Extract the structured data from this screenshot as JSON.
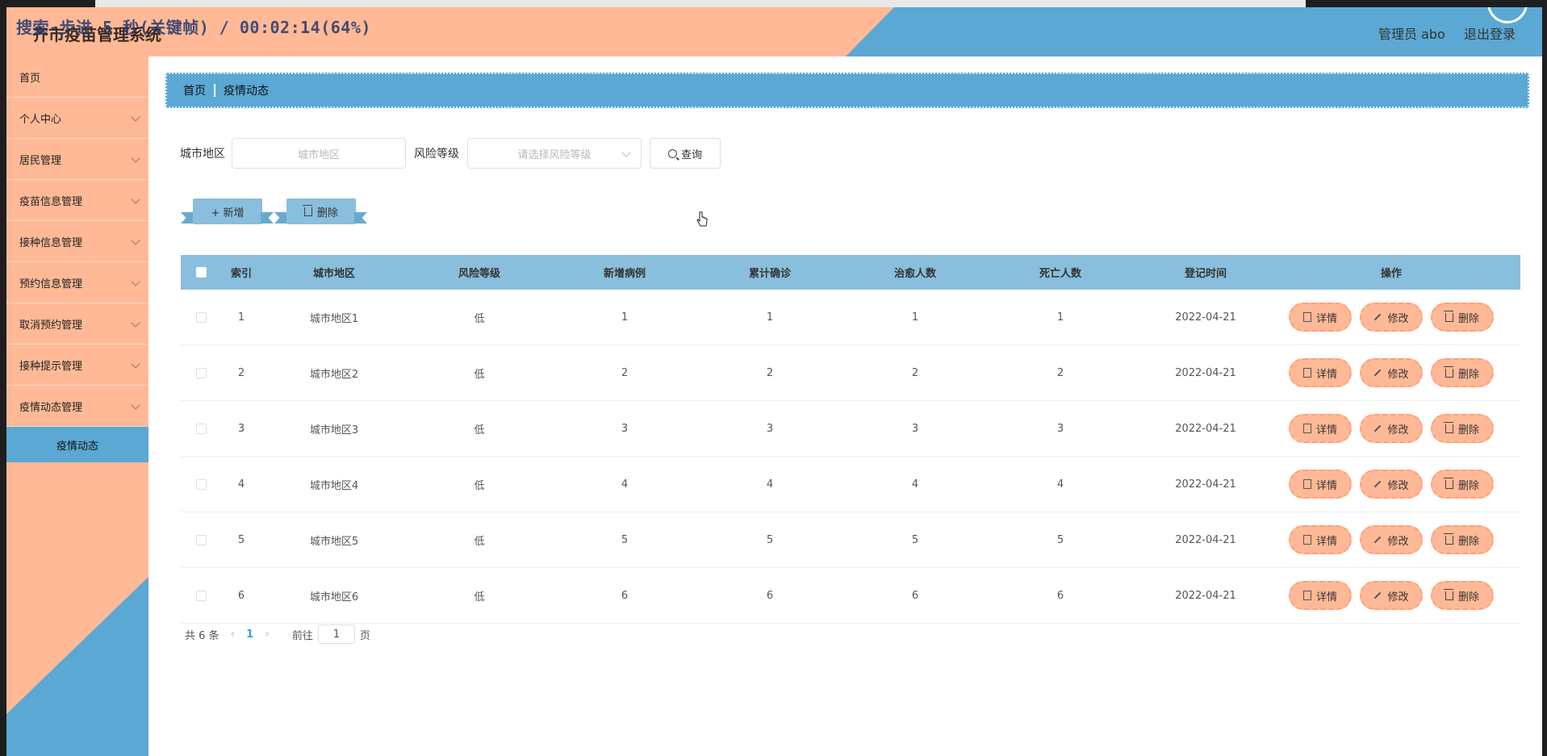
{
  "header": {
    "title": "齐市疫苗管理系统",
    "overlay": "搜索-步进 5 秒(关键帧) / 00:02:14(64%)",
    "user": "管理员 abo",
    "logout": "退出登录"
  },
  "sidebar": {
    "items": [
      {
        "label": "首页"
      },
      {
        "label": "个人中心"
      },
      {
        "label": "居民管理"
      },
      {
        "label": "疫苗信息管理"
      },
      {
        "label": "接种信息管理"
      },
      {
        "label": "预约信息管理"
      },
      {
        "label": "取消预约管理"
      },
      {
        "label": "接种提示管理"
      },
      {
        "label": "疫情动态管理"
      }
    ],
    "active_sub": "疫情动态"
  },
  "breadcrumb": {
    "home": "首页",
    "current": "疫情动态"
  },
  "search": {
    "city_label": "城市地区",
    "city_placeholder": "城市地区",
    "risk_label": "风险等级",
    "risk_placeholder": "请选择风险等级",
    "query_label": "查询"
  },
  "toolbar": {
    "add_label": "+ 新增",
    "delete_label": "删除"
  },
  "table": {
    "headers": [
      "索引",
      "城市地区",
      "风险等级",
      "新增病例",
      "累计确诊",
      "治愈人数",
      "死亡人数",
      "登记时间",
      "操作"
    ],
    "rows": [
      [
        "1",
        "城市地区1",
        "低",
        "1",
        "1",
        "1",
        "1",
        "2022-04-21"
      ],
      [
        "2",
        "城市地区2",
        "低",
        "2",
        "2",
        "2",
        "2",
        "2022-04-21"
      ],
      [
        "3",
        "城市地区3",
        "低",
        "3",
        "3",
        "3",
        "3",
        "2022-04-21"
      ],
      [
        "4",
        "城市地区4",
        "低",
        "4",
        "4",
        "4",
        "4",
        "2022-04-21"
      ],
      [
        "5",
        "城市地区5",
        "低",
        "5",
        "5",
        "5",
        "5",
        "2022-04-21"
      ],
      [
        "6",
        "城市地区6",
        "低",
        "6",
        "6",
        "6",
        "6",
        "2022-04-21"
      ]
    ],
    "ops": {
      "detail": "详情",
      "edit": "修改",
      "delete": "删除"
    }
  },
  "pager": {
    "total": "共 6 条",
    "current": "1",
    "goto": "前往",
    "page_value": "1",
    "page_unit": "页"
  }
}
